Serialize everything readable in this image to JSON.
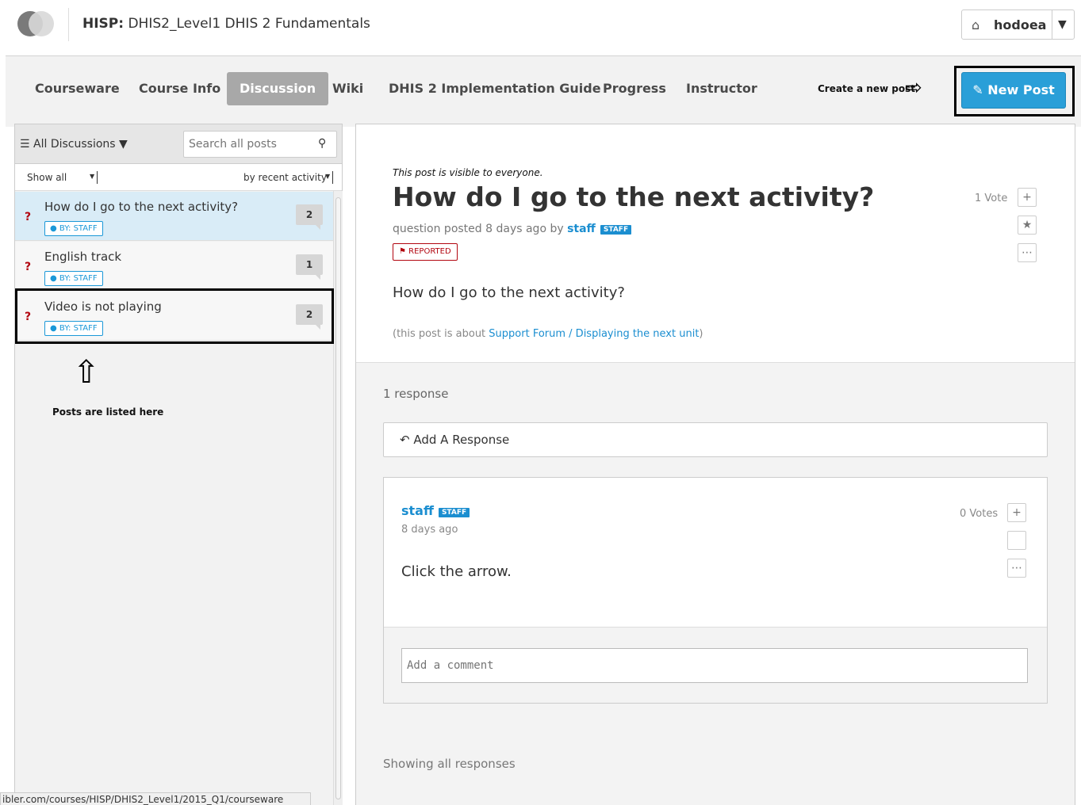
{
  "header": {
    "course_prefix": "HISP:",
    "course_name": " DHIS2_Level1 DHIS 2 Fundamentals",
    "username": "hodoea"
  },
  "nav": {
    "tabs": [
      {
        "label": "Courseware"
      },
      {
        "label": "Course Info"
      },
      {
        "label": "Discussion",
        "active": true
      },
      {
        "label": "Wiki"
      },
      {
        "label": "DHIS 2 Implementation Guide"
      },
      {
        "label": "Progress"
      },
      {
        "label": "Instructor"
      }
    ],
    "create_note": "Create a new post",
    "new_post_label": "New Post"
  },
  "sidebar": {
    "menu_label": "All Discussions ▼",
    "search_placeholder": "Search all posts",
    "filter_label": "Show all",
    "sort_label": "by recent activity",
    "posts": [
      {
        "title": "How do I go to the next activity?",
        "badge": "BY: STAFF",
        "count": "2",
        "selected": true
      },
      {
        "title": "English track",
        "badge": "BY: STAFF",
        "count": "1"
      },
      {
        "title": "Video is not playing",
        "badge": "BY: STAFF",
        "count": "2"
      }
    ],
    "annotation": "Posts are listed here",
    "status_url": "ibler.com/courses/HISP/DHIS2_Level1/2015_Q1/courseware"
  },
  "post": {
    "visibility": "This post is visible to everyone.",
    "title": "How do I go to the next activity?",
    "meta_prefix": "question posted 8 days ago by ",
    "author": "staff",
    "author_tag": "STAFF",
    "reported_label": "REPORTED",
    "votes": "1 Vote",
    "body": "How do I go to the next activity?",
    "about_prefix": "(this post is about ",
    "about_link": "Support Forum / Displaying the next unit",
    "about_suffix": ")"
  },
  "responses": {
    "count_label": "1 response",
    "add_label": "Add A Response",
    "items": [
      {
        "author": "staff",
        "author_tag": "STAFF",
        "time": "8 days ago",
        "body": "Click the arrow.",
        "votes": "0 Votes"
      }
    ],
    "comment_placeholder": "Add a comment",
    "showing_all": "Showing all responses"
  },
  "colors": {
    "accent": "#1b8ed0",
    "new_post_button": "#2a9fd8",
    "reported": "#b20610",
    "selected_item": "#d9ecf7",
    "active_tab": "#a8a8a8"
  }
}
